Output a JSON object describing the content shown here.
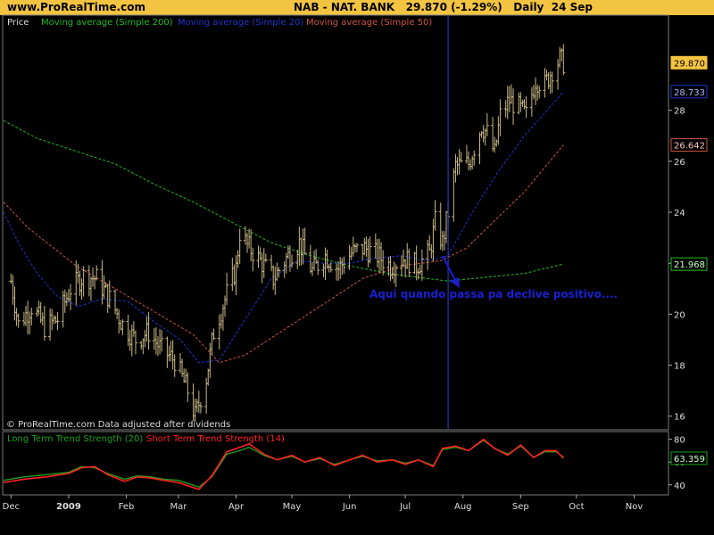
{
  "header": {
    "site": "www.ProRealTime.com",
    "symbol": "NAB - NAT. BANK",
    "last": "29.870 (-1.29%)",
    "interval": "Daily",
    "date": "24 Sep"
  },
  "colors": {
    "header_bg": "#f3c441",
    "bars": "#c8b885",
    "ma200": "#22bb22",
    "ma20": "#2233cc",
    "ma50": "#cc5544",
    "lt_strength": "#1ea01e",
    "st_strength": "#ff2020",
    "vline": "#2f3fe0",
    "annotation": "#1a1fd0"
  },
  "chart_data": [
    {
      "type": "line",
      "panel": "price",
      "legend": [
        "Price",
        "Moving average (Simple 200)",
        "Moving average (Simple 20)",
        "Moving average (Simple 50)"
      ],
      "footer": "© ProRealTime.com  Data adjusted after dividends",
      "annotation": "Aqui quando passa pa declive positivo....",
      "y_ticks": [
        16,
        18,
        20,
        22,
        24,
        26,
        28
      ],
      "ylim": [
        15.5,
        31.7
      ],
      "value_labels": [
        {
          "text": "29.870",
          "value": 29.87,
          "series": "price"
        },
        {
          "text": "28.733",
          "value": 28.733,
          "series": "ma20"
        },
        {
          "text": "26.642",
          "value": 26.642,
          "series": "ma50"
        },
        {
          "text": "21.968",
          "value": 21.968,
          "series": "ma200"
        }
      ],
      "vertical_marker_date": "2009-07-24",
      "price_path": [
        [
          "2008-12-01",
          21.3
        ],
        [
          "2008-12-05",
          19.6
        ],
        [
          "2008-12-12",
          20.3
        ],
        [
          "2008-12-19",
          19.5
        ],
        [
          "2008-12-26",
          19.8
        ],
        [
          "2009-01-02",
          21.0
        ],
        [
          "2009-01-09",
          21.5
        ],
        [
          "2009-01-16",
          21.4
        ],
        [
          "2009-01-23",
          20.6
        ],
        [
          "2009-01-30",
          19.6
        ],
        [
          "2009-02-06",
          19.0
        ],
        [
          "2009-02-13",
          19.3
        ],
        [
          "2009-02-20",
          18.6
        ],
        [
          "2009-02-27",
          18.2
        ],
        [
          "2009-03-06",
          17.0
        ],
        [
          "2009-03-10",
          16.0
        ],
        [
          "2009-03-16",
          17.5
        ],
        [
          "2009-03-20",
          19.3
        ],
        [
          "2009-03-27",
          20.8
        ],
        [
          "2009-04-01",
          21.8
        ],
        [
          "2009-04-03",
          23.2
        ],
        [
          "2009-04-07",
          22.7
        ],
        [
          "2009-04-14",
          22.1
        ],
        [
          "2009-04-21",
          21.4
        ],
        [
          "2009-04-28",
          22.2
        ],
        [
          "2009-05-05",
          22.8
        ],
        [
          "2009-05-12",
          21.7
        ],
        [
          "2009-05-19",
          22.3
        ],
        [
          "2009-05-26",
          21.8
        ],
        [
          "2009-06-02",
          22.4
        ],
        [
          "2009-06-09",
          22.6
        ],
        [
          "2009-06-16",
          22.3
        ],
        [
          "2009-06-23",
          21.9
        ],
        [
          "2009-06-30",
          22.2
        ],
        [
          "2009-07-07",
          21.9
        ],
        [
          "2009-07-14",
          22.4
        ],
        [
          "2009-07-17",
          23.6
        ],
        [
          "2009-07-21",
          22.8
        ],
        [
          "2009-07-24",
          24.0
        ],
        [
          "2009-07-28",
          25.8
        ],
        [
          "2009-08-04",
          25.9
        ],
        [
          "2009-08-11",
          27.4
        ],
        [
          "2009-08-14",
          27.1
        ],
        [
          "2009-08-18",
          26.3
        ],
        [
          "2009-08-21",
          27.8
        ],
        [
          "2009-08-26",
          28.4
        ],
        [
          "2009-08-31",
          28.1
        ],
        [
          "2009-09-04",
          27.8
        ],
        [
          "2009-09-09",
          29.2
        ],
        [
          "2009-09-14",
          29.0
        ],
        [
          "2009-09-18",
          29.6
        ],
        [
          "2009-09-22",
          30.0
        ],
        [
          "2009-09-24",
          29.87
        ]
      ],
      "series": [
        {
          "name": "Moving average (Simple 200)",
          "key": "ma200",
          "points": [
            [
              "2008-11-27",
              27.6
            ],
            [
              "2008-12-15",
              26.9
            ],
            [
              "2009-01-05",
              26.4
            ],
            [
              "2009-01-26",
              25.9
            ],
            [
              "2009-02-16",
              25.1
            ],
            [
              "2009-03-09",
              24.4
            ],
            [
              "2009-03-30",
              23.6
            ],
            [
              "2009-04-20",
              22.8
            ],
            [
              "2009-05-11",
              22.3
            ],
            [
              "2009-06-01",
              21.9
            ],
            [
              "2009-06-22",
              21.6
            ],
            [
              "2009-07-13",
              21.4
            ],
            [
              "2009-07-24",
              21.3
            ],
            [
              "2009-08-06",
              21.4
            ],
            [
              "2009-08-20",
              21.5
            ],
            [
              "2009-09-03",
              21.6
            ],
            [
              "2009-09-24",
              21.968
            ]
          ]
        },
        {
          "name": "Moving average (Simple 20)",
          "key": "ma20",
          "points": [
            [
              "2008-11-27",
              24.0
            ],
            [
              "2008-12-05",
              22.8
            ],
            [
              "2008-12-15",
              21.6
            ],
            [
              "2008-12-26",
              20.7
            ],
            [
              "2009-01-06",
              20.3
            ],
            [
              "2009-01-19",
              20.6
            ],
            [
              "2009-02-02",
              20.5
            ],
            [
              "2009-02-16",
              19.7
            ],
            [
              "2009-03-02",
              19.0
            ],
            [
              "2009-03-12",
              18.1
            ],
            [
              "2009-03-23",
              18.2
            ],
            [
              "2009-04-06",
              19.8
            ],
            [
              "2009-04-20",
              21.4
            ],
            [
              "2009-05-04",
              22.1
            ],
            [
              "2009-05-18",
              22.0
            ],
            [
              "2009-06-01",
              22.0
            ],
            [
              "2009-06-15",
              22.2
            ],
            [
              "2009-06-29",
              22.3
            ],
            [
              "2009-07-13",
              22.1
            ],
            [
              "2009-07-24",
              22.3
            ],
            [
              "2009-08-06",
              24.0
            ],
            [
              "2009-08-20",
              25.6
            ],
            [
              "2009-09-03",
              27.0
            ],
            [
              "2009-09-14",
              27.9
            ],
            [
              "2009-09-24",
              28.733
            ]
          ]
        },
        {
          "name": "Moving average (Simple 50)",
          "key": "ma50",
          "points": [
            [
              "2008-11-27",
              24.4
            ],
            [
              "2008-12-10",
              23.4
            ],
            [
              "2009-01-05",
              21.9
            ],
            [
              "2009-01-26",
              21.0
            ],
            [
              "2009-02-16",
              20.1
            ],
            [
              "2009-03-09",
              19.2
            ],
            [
              "2009-03-23",
              18.1
            ],
            [
              "2009-04-06",
              18.4
            ],
            [
              "2009-04-27",
              19.4
            ],
            [
              "2009-05-18",
              20.4
            ],
            [
              "2009-06-08",
              21.4
            ],
            [
              "2009-06-29",
              21.9
            ],
            [
              "2009-07-20",
              22.1
            ],
            [
              "2009-08-03",
              22.6
            ],
            [
              "2009-08-17",
              23.6
            ],
            [
              "2009-09-03",
              24.8
            ],
            [
              "2009-09-24",
              26.642
            ]
          ]
        }
      ]
    },
    {
      "type": "line",
      "panel": "indicator",
      "legend": [
        "Long Term Trend Strength (20)",
        "Short Term Trend Strength (14)"
      ],
      "y_ticks": [
        40,
        60,
        80
      ],
      "ylim": [
        32,
        86
      ],
      "value_label": "63.359",
      "series": [
        {
          "name": "Short Term Trend Strength (14)",
          "key": "st",
          "points": [
            [
              "2008-11-27",
              42
            ],
            [
              "2008-12-08",
              45
            ],
            [
              "2008-12-20",
              47
            ],
            [
              "2009-01-01",
              50
            ],
            [
              "2009-01-08",
              55
            ],
            [
              "2009-01-15",
              56
            ],
            [
              "2009-01-22",
              49
            ],
            [
              "2009-01-31",
              43
            ],
            [
              "2009-02-07",
              47
            ],
            [
              "2009-02-14",
              46
            ],
            [
              "2009-02-21",
              44
            ],
            [
              "2009-03-01",
              42
            ],
            [
              "2009-03-12",
              36
            ],
            [
              "2009-03-19",
              48
            ],
            [
              "2009-03-27",
              69
            ],
            [
              "2009-04-03",
              73
            ],
            [
              "2009-04-08",
              76
            ],
            [
              "2009-04-16",
              67
            ],
            [
              "2009-04-23",
              62
            ],
            [
              "2009-05-01",
              66
            ],
            [
              "2009-05-08",
              60
            ],
            [
              "2009-05-16",
              64
            ],
            [
              "2009-05-24",
              57
            ],
            [
              "2009-06-01",
              62
            ],
            [
              "2009-06-08",
              66
            ],
            [
              "2009-06-16",
              60
            ],
            [
              "2009-06-24",
              62
            ],
            [
              "2009-07-01",
              58
            ],
            [
              "2009-07-08",
              62
            ],
            [
              "2009-07-16",
              56
            ],
            [
              "2009-07-21",
              72
            ],
            [
              "2009-07-28",
              74
            ],
            [
              "2009-08-04",
              70
            ],
            [
              "2009-08-12",
              80
            ],
            [
              "2009-08-18",
              72
            ],
            [
              "2009-08-25",
              66
            ],
            [
              "2009-09-01",
              75
            ],
            [
              "2009-09-08",
              64
            ],
            [
              "2009-09-14",
              70
            ],
            [
              "2009-09-20",
              70
            ],
            [
              "2009-09-24",
              63.359
            ]
          ]
        },
        {
          "name": "Long Term Trend Strength (20)",
          "key": "lt",
          "points": [
            [
              "2008-11-27",
              44
            ],
            [
              "2008-12-08",
              47
            ],
            [
              "2008-12-20",
              49
            ],
            [
              "2009-01-01",
              51
            ],
            [
              "2009-01-08",
              56
            ],
            [
              "2009-01-15",
              55
            ],
            [
              "2009-01-22",
              50
            ],
            [
              "2009-01-31",
              45
            ],
            [
              "2009-02-07",
              48
            ],
            [
              "2009-02-14",
              47
            ],
            [
              "2009-02-21",
              45
            ],
            [
              "2009-03-01",
              44
            ],
            [
              "2009-03-12",
              38
            ],
            [
              "2009-03-19",
              47
            ],
            [
              "2009-03-27",
              67
            ],
            [
              "2009-04-03",
              70
            ],
            [
              "2009-04-08",
              73
            ],
            [
              "2009-04-16",
              66
            ],
            [
              "2009-04-23",
              62
            ],
            [
              "2009-05-01",
              65
            ],
            [
              "2009-05-08",
              60
            ],
            [
              "2009-05-16",
              63
            ],
            [
              "2009-05-24",
              58
            ],
            [
              "2009-06-01",
              62
            ],
            [
              "2009-06-08",
              65
            ],
            [
              "2009-06-16",
              61
            ],
            [
              "2009-06-24",
              62
            ],
            [
              "2009-07-01",
              59
            ],
            [
              "2009-07-08",
              62
            ],
            [
              "2009-07-16",
              57
            ],
            [
              "2009-07-21",
              71
            ],
            [
              "2009-07-28",
              73
            ],
            [
              "2009-08-04",
              70
            ],
            [
              "2009-08-12",
              79
            ],
            [
              "2009-08-18",
              72
            ],
            [
              "2009-08-25",
              67
            ],
            [
              "2009-09-01",
              74
            ],
            [
              "2009-09-08",
              64
            ],
            [
              "2009-09-14",
              69
            ],
            [
              "2009-09-20",
              69
            ],
            [
              "2009-09-24",
              64.5
            ]
          ]
        }
      ]
    }
  ],
  "x_axis": {
    "start": "2008-11-27",
    "end": "2009-11-19",
    "labels": [
      {
        "text": "Dec",
        "date": "2008-12-01",
        "bold": false
      },
      {
        "text": "2009",
        "date": "2009-01-01",
        "bold": true
      },
      {
        "text": "Feb",
        "date": "2009-02-01",
        "bold": false
      },
      {
        "text": "Mar",
        "date": "2009-03-01",
        "bold": false
      },
      {
        "text": "Apr",
        "date": "2009-04-01",
        "bold": false
      },
      {
        "text": "May",
        "date": "2009-05-01",
        "bold": false
      },
      {
        "text": "Jun",
        "date": "2009-06-01",
        "bold": false
      },
      {
        "text": "Jul",
        "date": "2009-07-01",
        "bold": false
      },
      {
        "text": "Aug",
        "date": "2009-08-01",
        "bold": false
      },
      {
        "text": "Sep",
        "date": "2009-09-01",
        "bold": false
      },
      {
        "text": "Oct",
        "date": "2009-10-01",
        "bold": false
      },
      {
        "text": "Nov",
        "date": "2009-11-01",
        "bold": false
      }
    ]
  }
}
